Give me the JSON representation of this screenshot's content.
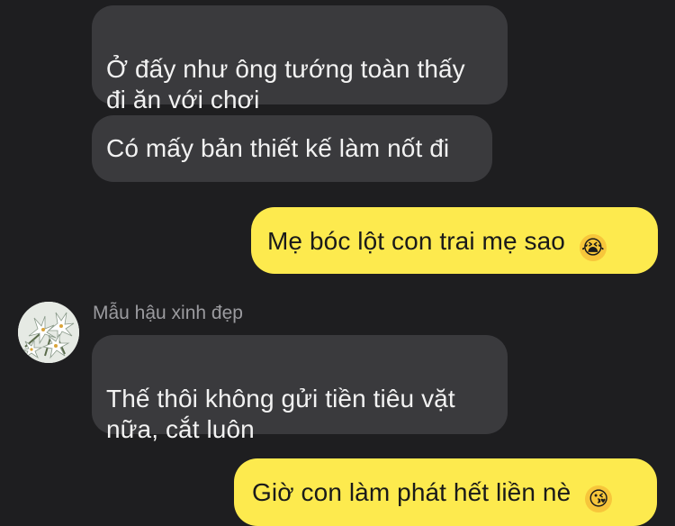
{
  "messages": [
    {
      "direction": "incoming",
      "text": "Ở đấy như ông tướng toàn thấy\nđi ăn với chơi"
    },
    {
      "direction": "incoming",
      "text": "Có mấy bản thiết kế làm nốt đi"
    },
    {
      "direction": "outgoing",
      "text": "Mẹ bóc lột con trai mẹ sao",
      "emoji": "crying-face"
    },
    {
      "direction": "incoming",
      "sender": "Mẫu hậu xinh đẹp",
      "text": "Thế thôi không gửi tiền tiêu vặt\nnữa, cắt luôn"
    },
    {
      "direction": "outgoing",
      "text": "Giờ con làm phát hết liền nè",
      "emoji": "kissing-face"
    }
  ],
  "colors": {
    "background": "#1e1e20",
    "incoming_bubble": "#3a3a3d",
    "outgoing_bubble": "#fdea4e"
  }
}
